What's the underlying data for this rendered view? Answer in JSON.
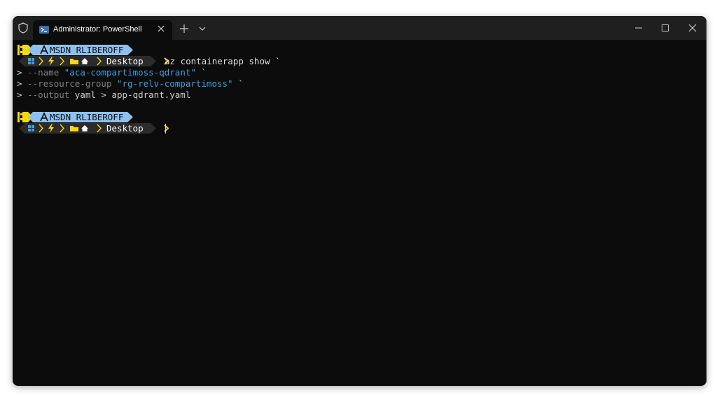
{
  "window": {
    "tab_title": "Administrator: PowerShell",
    "icons": {
      "shield": "shield-icon",
      "tab": "powershell-icon",
      "close_tab": "close-icon",
      "new_tab": "plus-icon",
      "dropdown": "chevron-down-icon",
      "minimize": "minimize-icon",
      "maximize": "maximize-icon",
      "close_window": "close-icon"
    }
  },
  "colors": {
    "background": "#0c0c0c",
    "titlebar": "#1f1f1f",
    "prompt_blue": "#8fc1ee",
    "prompt_dark": "#2b2b2b",
    "accent_yellow": "#f5d90a",
    "string_blue": "#3aa2e8",
    "param_gray": "#808080",
    "text": "#cccccc"
  },
  "prompts": [
    {
      "account": "MSDN RLIBEROFF",
      "folder": "Desktop",
      "command": "az containerapp show `",
      "continuations": [
        {
          "prefix": "> ",
          "param": "--name ",
          "value": "\"aca-compartimoss-qdrant\"",
          "suffix": " `"
        },
        {
          "prefix": "> ",
          "param": "--resource-group ",
          "value": "\"rg-relv-compartimoss\"",
          "suffix": " `"
        },
        {
          "prefix": "> ",
          "param": "--output ",
          "value": "yaml > app-qdrant.yaml",
          "suffix": ""
        }
      ]
    },
    {
      "account": "MSDN RLIBEROFF",
      "folder": "Desktop",
      "command": ""
    }
  ]
}
